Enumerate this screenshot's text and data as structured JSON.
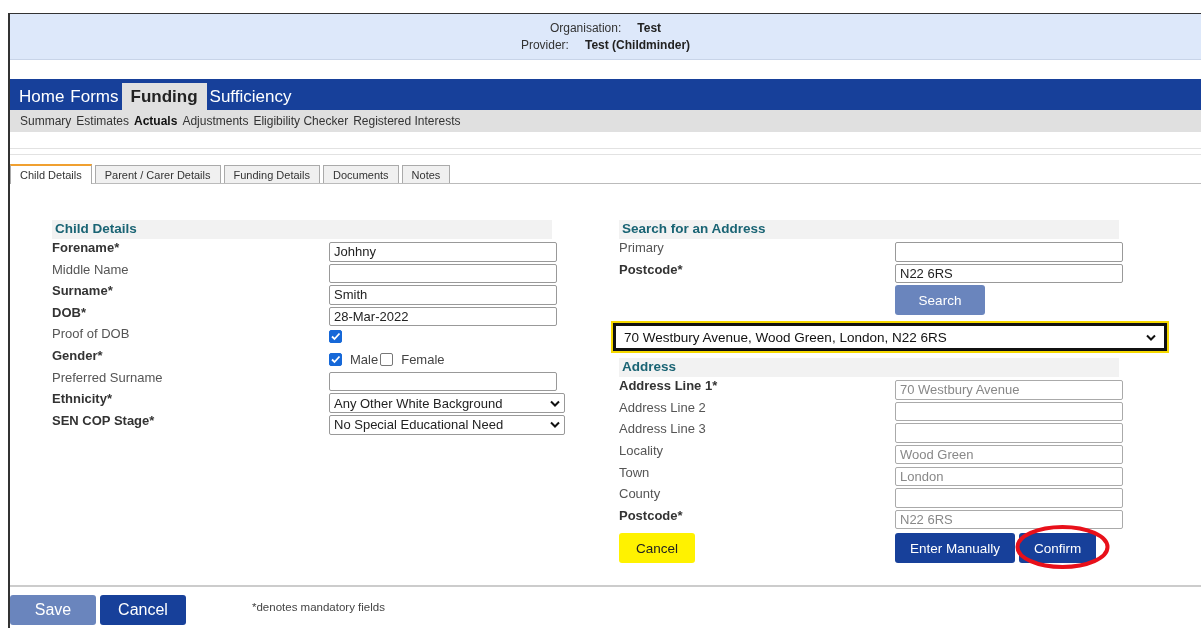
{
  "header": {
    "rows": [
      {
        "label": "Organisation:",
        "value": "Test"
      },
      {
        "label": "Provider:",
        "value": "Test (Childminder)"
      }
    ]
  },
  "nav": [
    {
      "label": "Home",
      "selected": false
    },
    {
      "label": "Forms",
      "selected": false
    },
    {
      "label": "Funding",
      "selected": true
    },
    {
      "label": "Sufficiency",
      "selected": false
    }
  ],
  "subnav": [
    {
      "label": "Summary",
      "selected": false
    },
    {
      "label": "Estimates",
      "selected": false
    },
    {
      "label": "Actuals",
      "selected": true
    },
    {
      "label": "Adjustments",
      "selected": false
    },
    {
      "label": "Eligibility Checker",
      "selected": false
    },
    {
      "label": "Registered Interests",
      "selected": false
    }
  ],
  "tabs": [
    {
      "label": "Child Details",
      "selected": true
    },
    {
      "label": "Parent / Carer Details",
      "selected": false
    },
    {
      "label": "Funding Details",
      "selected": false
    },
    {
      "label": "Documents",
      "selected": false
    },
    {
      "label": "Notes",
      "selected": false
    }
  ],
  "child_details": {
    "title": "Child Details",
    "fields": [
      {
        "kind": "text",
        "label": "Forename*",
        "required": true,
        "value": "Johhny"
      },
      {
        "kind": "text",
        "label": "Middle Name",
        "required": false
      },
      {
        "kind": "text",
        "label": "Surname*",
        "required": true,
        "value": "Smith"
      },
      {
        "kind": "text",
        "label": "DOB*",
        "required": true,
        "value": "28-Mar-2022"
      },
      {
        "kind": "checkbox",
        "label": "Proof of DOB",
        "required": false,
        "checked": true
      },
      {
        "kind": "options",
        "label": "Gender*",
        "required": true,
        "options": [
          {
            "label": "Male",
            "checked": true
          },
          {
            "label": "Female",
            "checked": false
          }
        ]
      },
      {
        "kind": "text",
        "label": "Preferred Surname",
        "required": false
      },
      {
        "kind": "select",
        "label": "Ethnicity*",
        "required": true,
        "value": "Any Other White Background"
      },
      {
        "kind": "select",
        "label": "SEN COP Stage*",
        "required": true,
        "value": "No Special Educational Need"
      }
    ]
  },
  "address_search": {
    "title": "Search for an Address",
    "fields": [
      {
        "kind": "text",
        "label": "Primary",
        "required": false
      },
      {
        "kind": "text",
        "label": "Postcode*",
        "required": true,
        "value": "N22 6RS"
      }
    ],
    "search_button": {
      "label": "Search",
      "disabled": true
    },
    "results": {
      "value": "70 Westbury Avenue, Wood Green, London, N22 6RS",
      "highlighted": true
    }
  },
  "address": {
    "title": "Address",
    "fields": [
      {
        "kind": "text",
        "label": "Address Line 1*",
        "required": true,
        "disabled": true,
        "value": "70 Westbury Avenue"
      },
      {
        "kind": "text",
        "label": "Address Line 2",
        "required": false,
        "disabled": true
      },
      {
        "kind": "text",
        "label": "Address Line 3",
        "required": false,
        "disabled": true
      },
      {
        "kind": "text",
        "label": "Locality",
        "required": false,
        "disabled": true,
        "value": "Wood Green"
      },
      {
        "kind": "text",
        "label": "Town",
        "required": false,
        "disabled": true,
        "value": "London"
      },
      {
        "kind": "text",
        "label": "County",
        "required": false,
        "disabled": true
      },
      {
        "kind": "text",
        "label": "Postcode*",
        "required": true,
        "disabled": true,
        "value": "N22 6RS"
      }
    ]
  },
  "address_buttons": [
    {
      "label": "Cancel",
      "kind": "highlight",
      "circled": false
    },
    {
      "label": "Enter Manually",
      "kind": "primary",
      "circled": false
    },
    {
      "label": "Confirm",
      "kind": "primary",
      "circled": true
    }
  ],
  "footer": {
    "buttons": [
      {
        "label": "Save",
        "disabled": true
      },
      {
        "label": "Cancel",
        "disabled": false
      }
    ],
    "note": "*denotes mandatory fields"
  }
}
